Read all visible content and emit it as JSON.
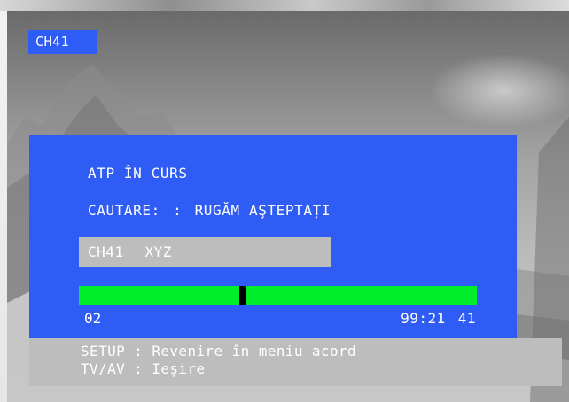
{
  "osd": {
    "channel_badge": "CH41",
    "status_title": "ATP ÎN CURS",
    "search": {
      "label": "CAUTARE:",
      "separator": ":",
      "message": "RUGĂM AŞTEPTAȚI"
    },
    "current_channel": {
      "number": "CH41",
      "name": "XYZ"
    },
    "progress": {
      "start_label": "02",
      "frequency": "99:21",
      "end_channel": "41",
      "position_fraction": 0.41
    },
    "help": [
      {
        "key": "SETUP",
        "separator": ":",
        "action": "Revenire în meniu acord"
      },
      {
        "key": "TV/AV",
        "separator": ":",
        "action": "Ieşire"
      }
    ]
  },
  "colors": {
    "panel_blue": "#2f5cf5",
    "progress_green": "#00ee2a",
    "field_gray": "#bdbdbd",
    "marker_black": "#000000"
  }
}
